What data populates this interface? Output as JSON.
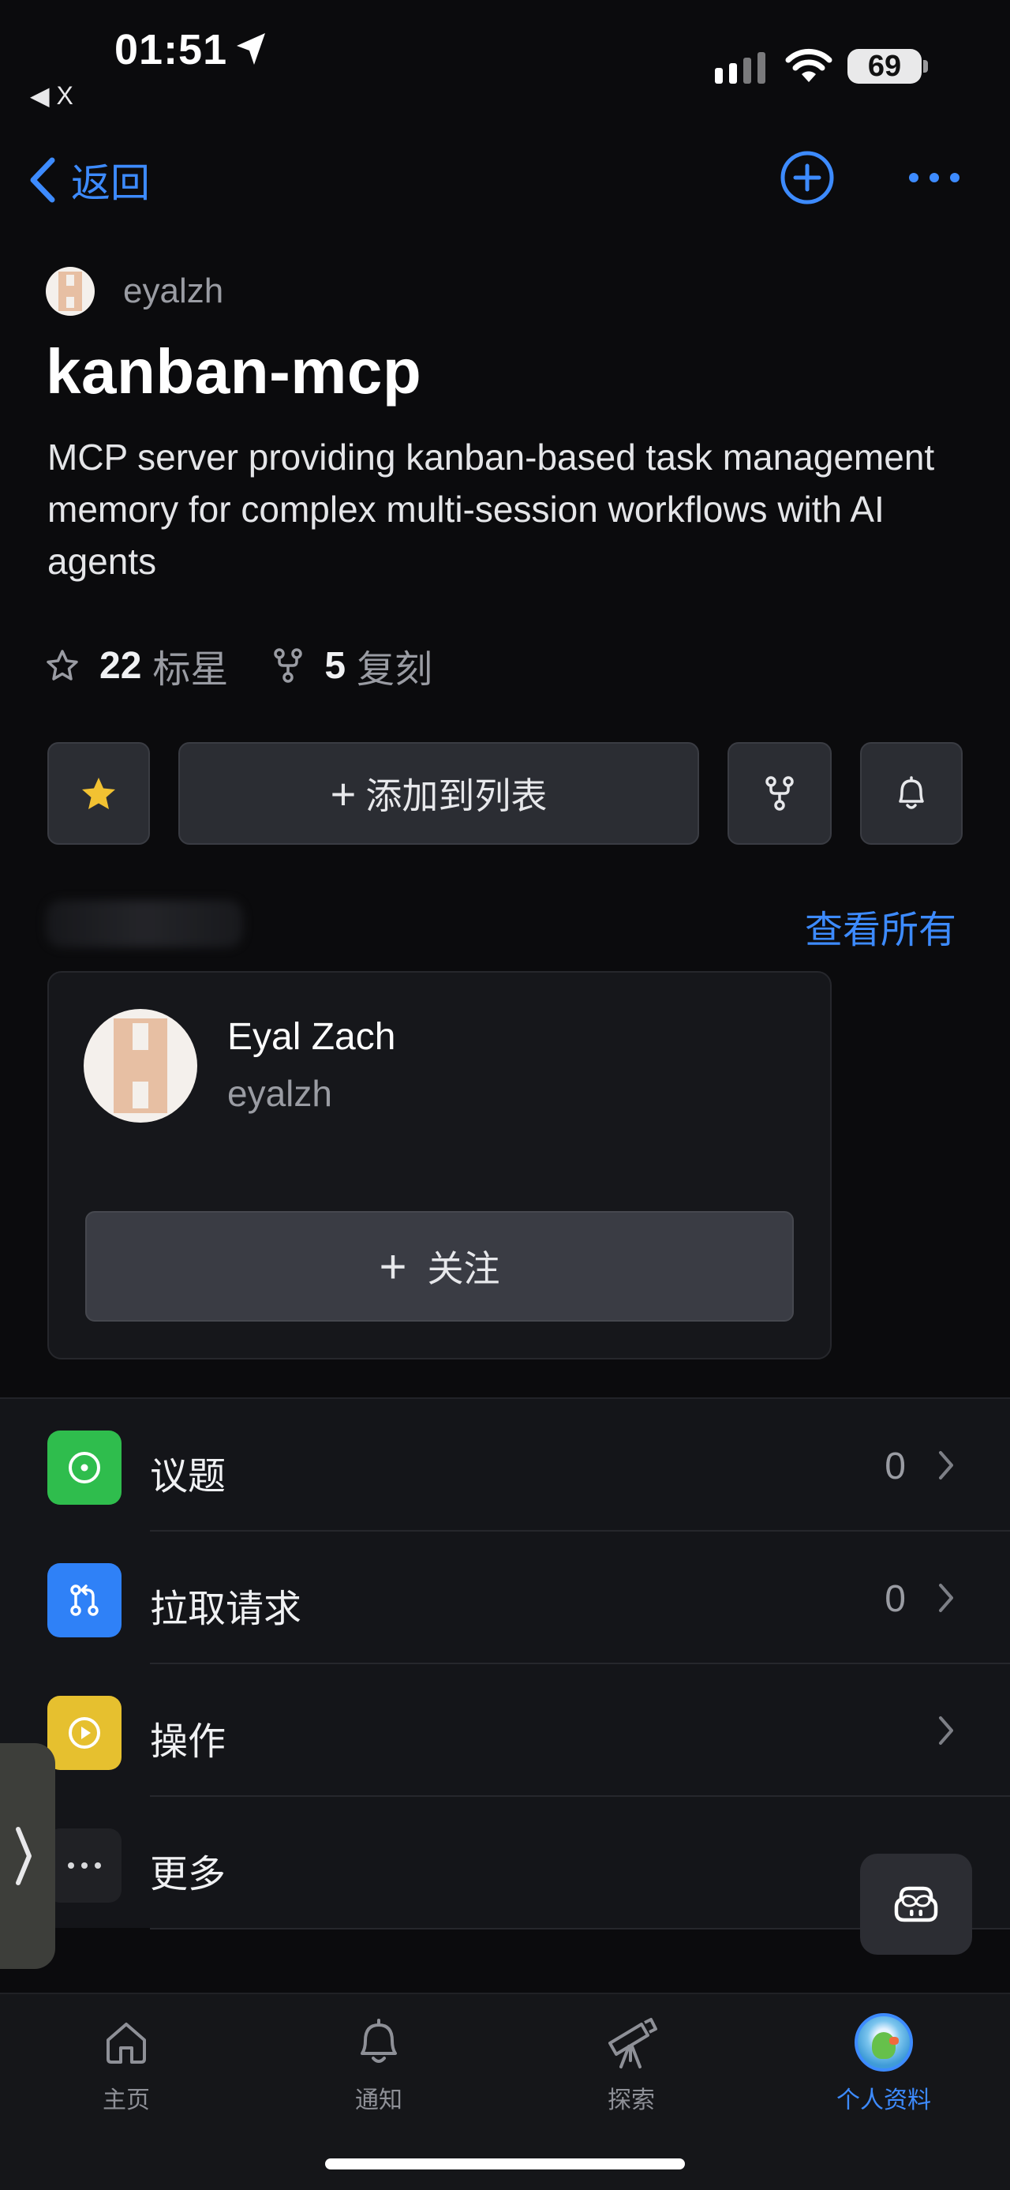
{
  "status_bar": {
    "time": "01:51",
    "back_app": "◀ X",
    "battery": "69"
  },
  "nav": {
    "back_label": "返回"
  },
  "repo": {
    "owner": "eyalzh",
    "name": "kanban-mcp",
    "description": "MCP server providing kanban-based task management memory for complex multi-session workflows with AI agents",
    "stars_count": "22",
    "stars_label": "标星",
    "forks_count": "5",
    "forks_label": "复刻"
  },
  "actions": {
    "add_to_list": "添加到列表"
  },
  "contributors": {
    "view_all": "查看所有",
    "card": {
      "name": "Eyal Zach",
      "login": "eyalzh",
      "follow": "关注"
    }
  },
  "menu": [
    {
      "label": "议题",
      "count": "0",
      "color": "#2fbd4d",
      "icon": "issue-icon"
    },
    {
      "label": "拉取请求",
      "count": "0",
      "color": "#2f81f7",
      "icon": "pull-request-icon"
    },
    {
      "label": "操作",
      "count": "",
      "color": "#e6c02f",
      "icon": "actions-play-icon"
    },
    {
      "label": "更多",
      "count": "",
      "color": "#202125",
      "icon": "more-icon"
    }
  ],
  "tabbar": {
    "home": "主页",
    "notifications": "通知",
    "explore": "探索",
    "profile": "个人资料"
  },
  "colors": {
    "accent": "#3d8bff",
    "background": "#0b0b0d",
    "star": "#f2c232"
  }
}
